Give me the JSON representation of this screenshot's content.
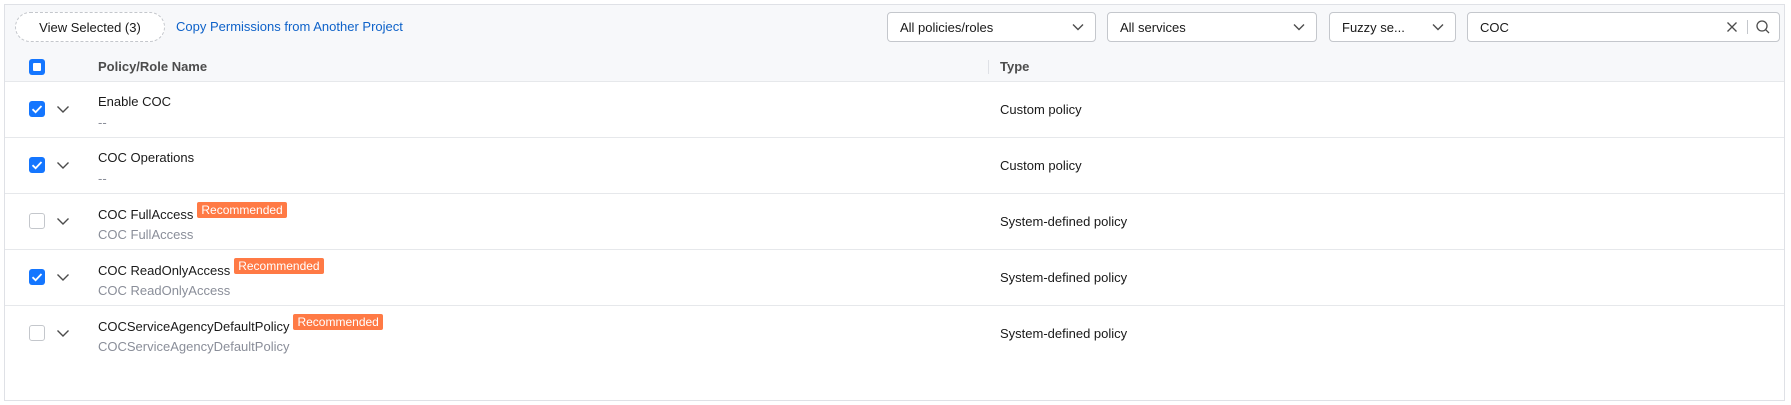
{
  "toolbar": {
    "view_selected_label": "View Selected (3)",
    "copy_link_label": "Copy Permissions from Another Project",
    "policy_filter": {
      "selected": "All policies/roles"
    },
    "service_filter": {
      "selected": "All services"
    },
    "match_filter": {
      "selected": "Fuzzy se..."
    },
    "search": {
      "value": "COC"
    }
  },
  "table": {
    "columns": [
      "Policy/Role Name",
      "Type"
    ],
    "header_checkbox": "partial",
    "rows": [
      {
        "name": "Enable COC",
        "description": "--",
        "badge": "",
        "type": "Custom policy",
        "checked": true
      },
      {
        "name": "COC Operations",
        "description": "--",
        "badge": "",
        "type": "Custom policy",
        "checked": true
      },
      {
        "name": "COC FullAccess",
        "description": "COC FullAccess",
        "badge": "Recommended",
        "type": "System-defined policy",
        "checked": false
      },
      {
        "name": "COC ReadOnlyAccess",
        "description": "COC ReadOnlyAccess",
        "badge": "Recommended",
        "type": "System-defined policy",
        "checked": true
      },
      {
        "name": "COCServiceAgencyDefaultPolicy",
        "description": "COCServiceAgencyDefaultPolicy",
        "badge": "Recommended",
        "type": "System-defined policy",
        "checked": false
      }
    ]
  },
  "colors": {
    "accent": "#1476ff",
    "link": "#0e62c9",
    "badge": "#ff7a45",
    "muted_text": "#8a8e99"
  },
  "icons": {
    "dropdown": "chevron-down-icon",
    "expand": "chevron-down-icon",
    "clear": "close-icon",
    "search": "search-icon",
    "check": "check-icon"
  }
}
